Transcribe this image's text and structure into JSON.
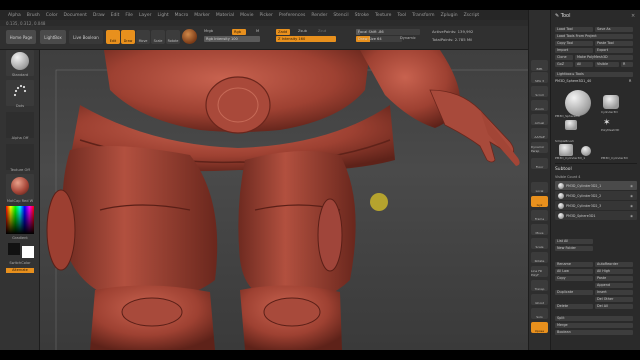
{
  "menubar": {
    "items": [
      "Alpha",
      "Brush",
      "Color",
      "Document",
      "Draw",
      "Edit",
      "File",
      "Layer",
      "Light",
      "Macro",
      "Marker",
      "Material",
      "Movie",
      "Picker",
      "Preferences",
      "Render",
      "Stencil",
      "Stroke",
      "Texture",
      "Tool",
      "Transform",
      "Zplugin",
      "Zscript"
    ]
  },
  "status_line": "0.135, 0.312, 0.048",
  "top_shelf": {
    "home_page": "Home Page",
    "lightbox": "LightBox",
    "live_boolean": "Live Boolean",
    "tools": [
      "Edit",
      "Draw",
      "Move",
      "Scale",
      "Rotate"
    ],
    "mrgb": "Mrgb",
    "rgb": "Rgb",
    "m": "M",
    "zadd": "Zadd",
    "zsub": "Zsub",
    "zcut": "Zcut",
    "rgb_intensity": "Rgb Intensity 100",
    "rgb_intensity_value": 100,
    "z_intensity": "Z Intensity 160",
    "z_intensity_value": 100,
    "focal_shift": "Focal Shift -86",
    "focal_shift_value": 0.07,
    "draw_size": "Draw Size 64",
    "draw_size_value": 0.3,
    "dynamic": "Dynamic",
    "active_points": "ActivePoints: 139,992",
    "total_points": "TotalPoints: 2.785 Mil"
  },
  "left_shelf": {
    "brush_label": "Standard",
    "stroke_label": "Dots",
    "alpha_label": "Alpha Off",
    "texture_label": "Texture Off",
    "material_label": "MatCap Red W",
    "gradient_label": "Gradient",
    "switch_color": "SwitchColor",
    "alternate": "Alternate"
  },
  "right_shelf": {
    "buttons": [
      "BPR",
      "SPix 3",
      "Scroll",
      "Zoom",
      "Actual",
      "AAHalf",
      "Dynamic Persp",
      "Floor",
      "Local",
      "Gyz",
      "Frame",
      "Move",
      "Scale",
      "Rotate",
      "Line Fill PolyF",
      "Transp",
      "Ghost",
      "Solo",
      "Xpose"
    ]
  },
  "tray": {
    "title": "Tool",
    "row1": [
      "Load Tool",
      "Save As"
    ],
    "row2": [
      "Load Tools From Project"
    ],
    "row3": [
      "Copy Tool",
      "Paste Tool"
    ],
    "row4": [
      "Import",
      "Export"
    ],
    "row5": [
      "Clone",
      "Make PolyMesh3D"
    ],
    "row6": [
      "GoZ",
      "All",
      "Visible",
      "R"
    ],
    "lightbox_tools": "Lightbox ▸ Tools",
    "current_tool": "PM3D_Sphere3D1_40",
    "tool_count": "R",
    "thumbs": [
      "PM3D_Sphere3D",
      "Cylinder3D",
      "PolyMesh3D",
      "SimpleBrush",
      "PM3D_Cylinder3D_1",
      "PM3D_Cylinder3D"
    ],
    "subtool_title": "Subtool",
    "visible_count": "Visible Count 4",
    "subtools": [
      "PM3D_Cylinder3D2_1",
      "PM3D_Cylinder3D2_2",
      "PM3D_Cylinder3D2_3",
      "PM3D_Sphere3D1"
    ],
    "list_all": "List All",
    "new_folder": "New Folder",
    "rename": "Rename",
    "autoreorder": "AutoReorder",
    "all_low": "All Low",
    "all_high": "All High",
    "copy": "Copy",
    "paste": "Paste",
    "append": "Append",
    "duplicate": "Duplicate",
    "insert": "Insert",
    "del_other": "Del Other",
    "delete": "Delete",
    "del_all": "Del All",
    "split": "Split",
    "merge": "Merge",
    "boolean": "Boolean"
  },
  "colors": {
    "accent": "#e8901d",
    "clay": "#a8483a",
    "background_top": "#3f3f3f",
    "cursor": "#c9b42a"
  }
}
